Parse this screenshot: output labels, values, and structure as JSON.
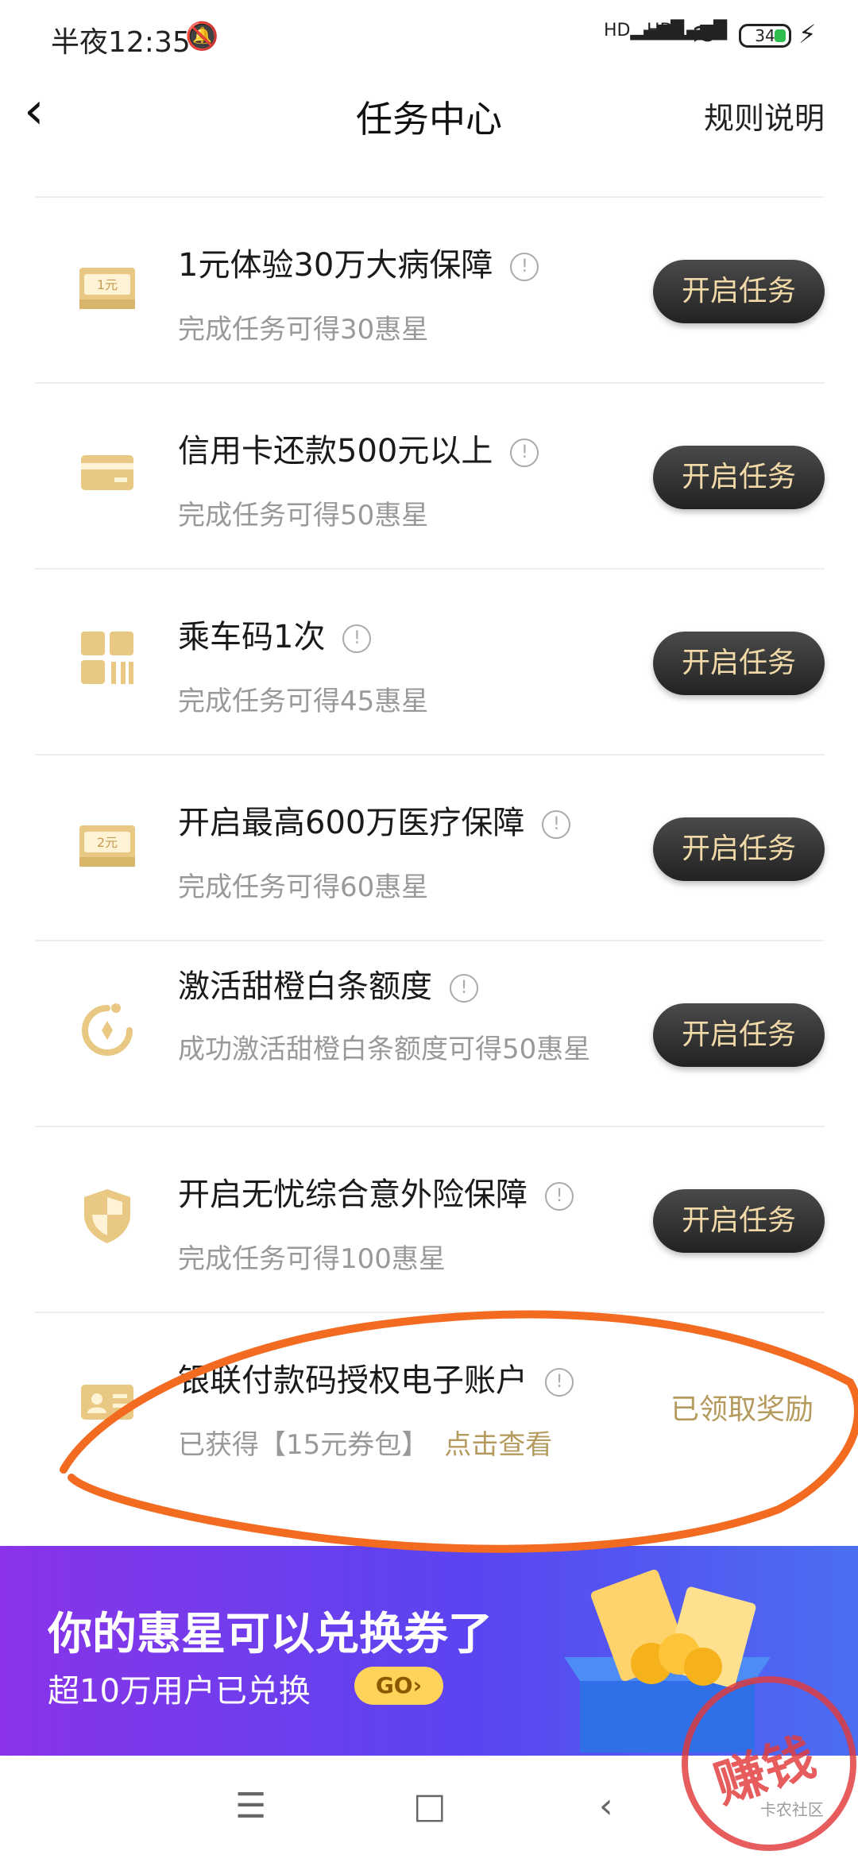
{
  "status_bar": {
    "time": "半夜12:35",
    "battery": "34"
  },
  "nav": {
    "title": "任务中心",
    "rules": "规则说明"
  },
  "tasks": [
    {
      "title": "1元体验30万大病保障",
      "subtitle": "完成任务可得30惠星",
      "action": "开启任务",
      "icon": "ticket-1yuan-icon",
      "icon_text": "1元"
    },
    {
      "title": "信用卡还款500元以上",
      "subtitle": "完成任务可得50惠星",
      "action": "开启任务",
      "icon": "credit-card-icon"
    },
    {
      "title": "乘车码1次",
      "subtitle": "完成任务可得45惠星",
      "action": "开启任务",
      "icon": "qr-code-icon"
    },
    {
      "title": "开启最高600万医疗保障",
      "subtitle": "完成任务可得60惠星",
      "action": "开启任务",
      "icon": "ticket-2yuan-icon",
      "icon_text": "2元"
    },
    {
      "title": "激活甜橙白条额度",
      "subtitle": "成功激活甜橙白条额度可得50惠星",
      "action": "开启任务",
      "icon": "orange-credit-icon"
    },
    {
      "title": "开启无忧综合意外险保障",
      "subtitle": "完成任务可得100惠星",
      "action": "开启任务",
      "icon": "shield-icon"
    },
    {
      "title": "银联付款码授权电子账户",
      "subtitle": "已获得【15元券包】",
      "link": "点击查看",
      "status": "已领取奖励",
      "icon": "id-card-icon"
    }
  ],
  "banner": {
    "title": "你的惠星可以兑换券了",
    "subtitle": "超10万用户已兑换",
    "go": "GO›"
  },
  "watermark": {
    "text": "赚钱",
    "sub": "卡农社区"
  },
  "colors": {
    "gold": "#d9b56a",
    "button_text": "#f1d9a8",
    "claimed": "#b59a5e",
    "annotation": "#f26b21",
    "stamp": "#e23a3a"
  }
}
